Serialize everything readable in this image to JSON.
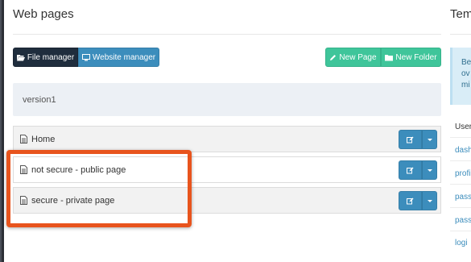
{
  "main": {
    "title": "Web pages",
    "toolbar": {
      "file_manager_label": "File manager",
      "website_manager_label": "Website manager",
      "new_page_label": "New Page",
      "new_folder_label": "New Folder"
    },
    "version_label": "version1",
    "pages": [
      {
        "label": "Home"
      },
      {
        "label": "not secure - public page"
      },
      {
        "label": "secure - private page"
      }
    ]
  },
  "side_panel": {
    "title": "Tem",
    "info_lines": [
      "Be",
      "ov",
      "mi"
    ],
    "table_header": "User",
    "links": [
      "dash",
      "profi",
      "pass",
      "pass",
      "logi"
    ]
  },
  "colors": {
    "primary": "#3c8dbc",
    "dark": "#1f2d3d",
    "success": "#3fc59a",
    "highlight": "#e8541d"
  }
}
